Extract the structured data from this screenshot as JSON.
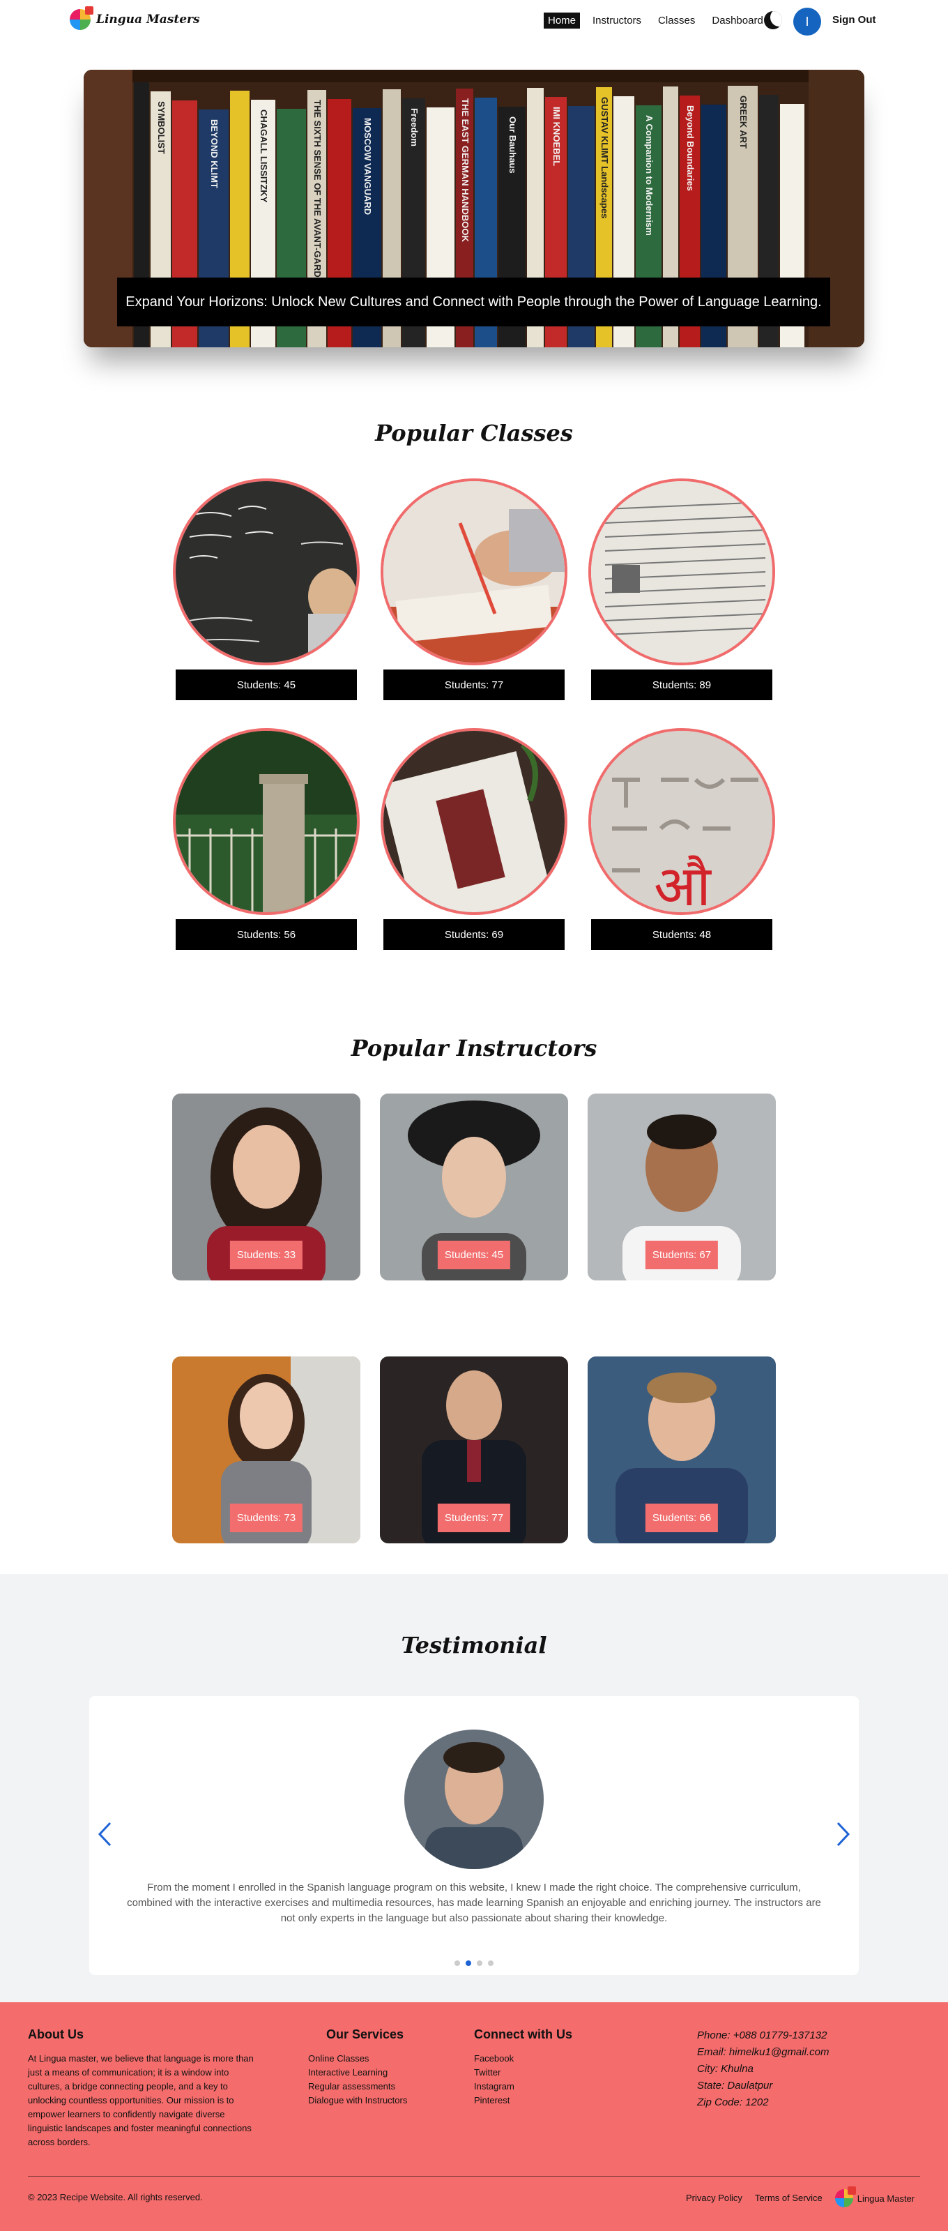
{
  "nav": {
    "brand": "Lingua Masters",
    "links": [
      "Home",
      "Instructors",
      "Classes",
      "Dashboard"
    ],
    "avatar_initial": "I",
    "signout": "Sign Out"
  },
  "hero": {
    "caption": "Expand Your Horizons: Unlock New Cultures and Connect with People through the Power of Language Learning.",
    "spines": [
      "SYMBOLIST",
      "BEYOND KLIMT",
      "CHAGALL LISSITZKY",
      "THE SIXTH SENSE OF THE AVANT-GARDE",
      "MOSCOW VANGUARD",
      "Freedom",
      "THE EAST GERMAN HANDBOOK",
      "Our Bauhaus",
      "IMI KNOEBEL",
      "GUSTAV KLIMT Landscapes",
      "A Companion to Modernism",
      "Beyond Boundaries",
      "GREEK ART"
    ]
  },
  "classes": {
    "title": "Popular Classes",
    "items": [
      {
        "label": "Students: 45"
      },
      {
        "label": "Students: 77"
      },
      {
        "label": "Students: 89"
      },
      {
        "label": "Students: 56"
      },
      {
        "label": "Students: 69"
      },
      {
        "label": "Students: 48"
      }
    ]
  },
  "instructors": {
    "title": "Popular Instructors",
    "items": [
      {
        "label": "Students: 33"
      },
      {
        "label": "Students: 45"
      },
      {
        "label": "Students: 67"
      },
      {
        "label": "Students: 73"
      },
      {
        "label": "Students: 77"
      },
      {
        "label": "Students: 66"
      }
    ]
  },
  "testimonial": {
    "title": "Testimonial",
    "text": "From the moment I enrolled in the Spanish language program on this website, I knew I made the right choice. The comprehensive curriculum, combined with the interactive exercises and multimedia resources, has made learning Spanish an enjoyable and enriching journey. The instructors are not only experts in the language but also passionate about sharing their knowledge."
  },
  "footer": {
    "about_title": "About Us",
    "about_text": "At Lingua master, we believe that language is more than just a means of communication; it is a window into cultures, a bridge connecting people, and a key to unlocking countless opportunities. Our mission is to empower learners to confidently navigate diverse linguistic landscapes and foster meaningful connections across borders.",
    "services_title": "Our Services",
    "services": [
      "Online Classes",
      "Interactive Learning",
      "Regular assessments",
      "Dialogue with Instructors"
    ],
    "connect_title": "Connect with Us",
    "connect": [
      "Facebook",
      "Twitter",
      "Instagram",
      "Pinterest"
    ],
    "contact": [
      "Phone: +088 01779-137132",
      "Email: himelku1@gmail.com",
      "City: Khulna",
      "State: Daulatpur",
      "Zip Code: 1202"
    ],
    "copyright": "© 2023 Recipe Website. All rights reserved.",
    "privacy": "Privacy Policy",
    "terms": "Terms of Service",
    "brand": "Lingua Master"
  },
  "colors": {
    "accent": "#f46c6c",
    "nav_active": "#111111",
    "avatar": "#1565c0",
    "carousel_arrow": "#1e63d6"
  }
}
